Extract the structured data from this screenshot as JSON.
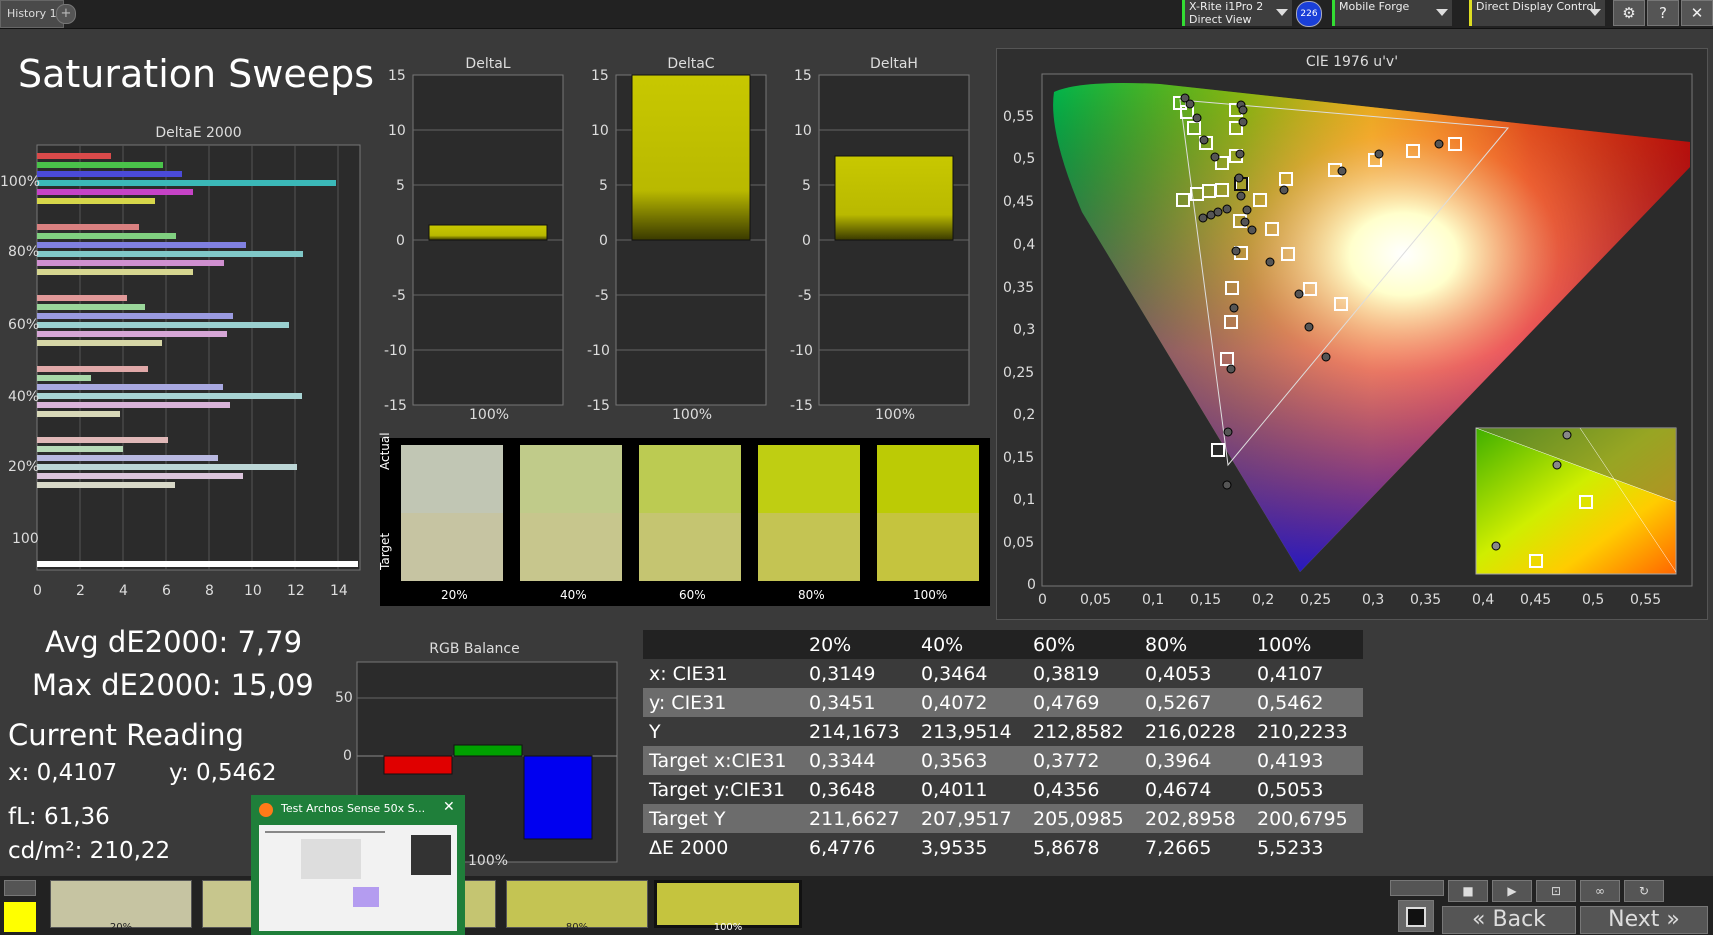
{
  "tabs": {
    "history": "History 1",
    "plus": "+"
  },
  "devices": [
    {
      "line1": "X-Rite i1Pro 2",
      "line2": "Direct View"
    },
    {
      "badge": "226"
    },
    {
      "line1": "Mobile Forge",
      "line2": ""
    },
    {
      "line1": "Direct Display Control",
      "line2": ""
    }
  ],
  "toolbar_icons": [
    "gear-icon",
    "help-icon",
    "close-icon"
  ],
  "toolbar_glyphs": {
    "gear": "⚙",
    "help": "?",
    "close": "✕"
  },
  "page_title": "Saturation Sweeps",
  "deltae_chart": {
    "title": "DeltaE 2000",
    "ylabels": [
      "100%",
      "80%",
      "60%",
      "40%",
      "20%",
      "100"
    ],
    "xticks": [
      "0",
      "2",
      "4",
      "6",
      "8",
      "10",
      "12",
      "14"
    ]
  },
  "delta_charts": [
    {
      "title": "DeltaL",
      "xlabel": "100%"
    },
    {
      "title": "DeltaC",
      "xlabel": "100%"
    },
    {
      "title": "DeltaH",
      "xlabel": "100%"
    }
  ],
  "delta_yticks": [
    "15",
    "10",
    "5",
    "0",
    "-5",
    "-10",
    "-15"
  ],
  "swatch_panel": {
    "actual_label": "Actual",
    "target_label": "Target",
    "labels": [
      "20%",
      "40%",
      "60%",
      "80%",
      "100%"
    ],
    "actual_colors": [
      "#c1c6b4",
      "#c0cb8a",
      "#bccb52",
      "#bfce12",
      "#bccb05"
    ],
    "target_colors": [
      "#c6c4a2",
      "#c7c68d",
      "#c5c571",
      "#c4c453",
      "#c5c43e"
    ]
  },
  "cie_chart": {
    "title": "CIE 1976 u'v'",
    "yticks": [
      "0,55",
      "0,5",
      "0,45",
      "0,4",
      "0,35",
      "0,3",
      "0,25",
      "0,2",
      "0,15",
      "0,1",
      "0,05",
      "0"
    ],
    "xticks": [
      "0",
      "0,05",
      "0,1",
      "0,15",
      "0,2",
      "0,25",
      "0,3",
      "0,35",
      "0,4",
      "0,45",
      "0,5",
      "0,55"
    ]
  },
  "stats": {
    "avg": "Avg dE2000: 7,79",
    "max": "Max dE2000: 15,09",
    "current_reading": "Current Reading",
    "x": "x: 0,4107",
    "y": "y: 0,5462",
    "fl": "fL: 61,36",
    "cdm2": "cd/m²: 210,22"
  },
  "rgb_balance": {
    "title": "RGB Balance",
    "yticks": [
      "50",
      "0"
    ],
    "xlabel": "100%"
  },
  "firefox_popup": {
    "title": "Test Archos Sense 50x S..."
  },
  "table": {
    "headers": [
      "",
      "20%",
      "40%",
      "60%",
      "80%",
      "100%"
    ],
    "rows": [
      [
        "x: CIE31",
        "0,3149",
        "0,3464",
        "0,3819",
        "0,4053",
        "0,4107"
      ],
      [
        "y: CIE31",
        "0,3451",
        "0,4072",
        "0,4769",
        "0,5267",
        "0,5462"
      ],
      [
        "Y",
        "214,1673",
        "213,9514",
        "212,8582",
        "216,0228",
        "210,2233"
      ],
      [
        "Target x:CIE31",
        "0,3344",
        "0,3563",
        "0,3772",
        "0,3964",
        "0,4193"
      ],
      [
        "Target y:CIE31",
        "0,3648",
        "0,4011",
        "0,4356",
        "0,4674",
        "0,5053"
      ],
      [
        "Target Y",
        "211,6627",
        "207,9517",
        "205,0985",
        "202,8958",
        "200,6795"
      ],
      [
        "ΔE 2000",
        "6,4776",
        "3,9535",
        "5,8678",
        "7,2665",
        "5,5233"
      ]
    ]
  },
  "bottom_swatches": {
    "labels": [
      "20%",
      "",
      "",
      "",
      "80%",
      "100%"
    ],
    "colors": [
      "#c6c4a2",
      "#c7c68d",
      "#c5c571",
      "#c4c453",
      "#c4c453",
      "#c5c43e"
    ]
  },
  "nav": {
    "back": "Back",
    "next": "Next",
    "back_glyph": "«",
    "next_glyph": "»"
  },
  "colors": {
    "accent_green": "#33dd33",
    "yellow": "#ffff00"
  }
}
